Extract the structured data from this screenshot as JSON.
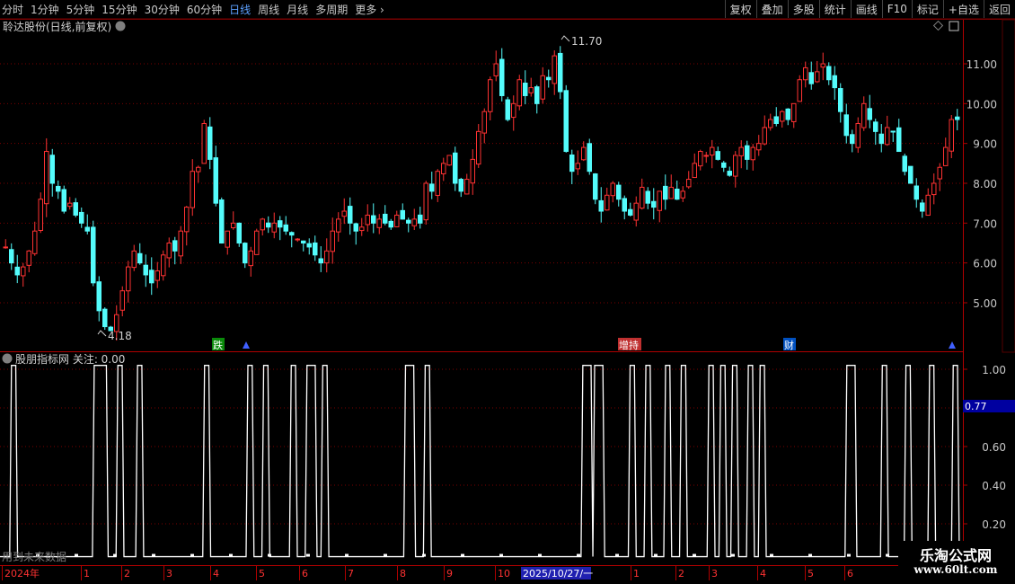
{
  "toolbar": {
    "periods": [
      "分时",
      "1分钟",
      "5分钟",
      "15分钟",
      "30分钟",
      "60分钟",
      "日线",
      "周线",
      "月线",
      "多周期",
      "更多"
    ],
    "active_period": "日线",
    "right_buttons": [
      "复权",
      "叠加",
      "多股",
      "统计",
      "画线",
      "F10",
      "标记",
      "+自选",
      "返回"
    ]
  },
  "stock": {
    "name": "聆达股份",
    "mode": "(日线,前复权)"
  },
  "indicator": {
    "name": "股朋指标网",
    "focus_label": "关注: 0.00",
    "current_value": "0.77"
  },
  "price_axis": [
    "11.00",
    "10.00",
    "9.00",
    "8.00",
    "7.00",
    "6.00",
    "5.00"
  ],
  "ind_axis": [
    "1.00",
    "0.80",
    "0.60",
    "0.40",
    "0.20"
  ],
  "annotations": {
    "high": "11.70",
    "low": "4.18"
  },
  "events": [
    "跌",
    "增持",
    "财"
  ],
  "bottom_text": "用到未来数据",
  "time_axis": {
    "labels": [
      "2024年",
      "1",
      "2",
      "3",
      "4",
      "5",
      "6",
      "7",
      "8",
      "9",
      "10",
      "2025/10/27/一",
      "1",
      "2",
      "3",
      "4",
      "5",
      "6"
    ],
    "cursor_date": "2025/10/27/一"
  },
  "watermark": {
    "title": "乐淘公式网",
    "url": "www.60lt.com"
  },
  "colors": {
    "up": "#ff3232",
    "down": "#54fcfc",
    "grid": "#7a0000",
    "axis_text": "#c8c8c8",
    "active": "#5ca0ff"
  },
  "chart_data": {
    "type": "candlestick+step",
    "price_ylim": [
      4.0,
      12.0
    ],
    "high": 11.7,
    "low": 4.18,
    "close_path": [
      6.4,
      6.0,
      5.7,
      5.9,
      6.3,
      6.8,
      7.6,
      8.8,
      8.0,
      7.8,
      7.3,
      7.5,
      7.2,
      7.0,
      6.8,
      5.5,
      4.8,
      4.4,
      4.3,
      4.7,
      5.3,
      5.9,
      6.3,
      6.0,
      5.7,
      5.5,
      5.8,
      6.2,
      6.5,
      6.3,
      6.8,
      7.4,
      8.3,
      8.4,
      9.5,
      8.6,
      7.5,
      6.5,
      6.8,
      7.0,
      6.5,
      6.0,
      6.3,
      6.8,
      7.1,
      6.9,
      7.0,
      6.9,
      6.8,
      6.7,
      6.6,
      6.5,
      6.4,
      6.2,
      6.0,
      6.3,
      6.8,
      7.1,
      7.3,
      7.0,
      6.8,
      6.9,
      7.2,
      7.0,
      7.1,
      7.0,
      6.9,
      7.2,
      7.1,
      7.0,
      7.1,
      7.0,
      8.0,
      7.8,
      8.3,
      8.5,
      8.7,
      8.0,
      7.8,
      8.1,
      8.6,
      9.3,
      9.8,
      10.6,
      11.0,
      10.2,
      9.6,
      10.0,
      10.6,
      10.2,
      10.4,
      10.0,
      10.7,
      10.6,
      11.2,
      10.3,
      8.8,
      8.3,
      8.5,
      8.9,
      8.3,
      7.6,
      7.3,
      7.7,
      8.0,
      7.6,
      7.3,
      7.2,
      7.5,
      7.9,
      7.5,
      7.4,
      7.8,
      7.6,
      7.9,
      7.6,
      7.8,
      8.1,
      8.5,
      8.8,
      8.7,
      8.9,
      8.6,
      8.4,
      8.2,
      8.7,
      8.9,
      8.6,
      8.9,
      9.0,
      9.4,
      9.6,
      9.5,
      9.8,
      9.6,
      10.0,
      10.6,
      10.9,
      10.5,
      10.8,
      11.0,
      10.6,
      10.4,
      9.8,
      9.2,
      9.0,
      9.5,
      10.0,
      9.6,
      9.3,
      9.0,
      9.4,
      9.3,
      8.8,
      8.3,
      8.0,
      7.6,
      7.3,
      7.7,
      8.0,
      8.4,
      8.9,
      9.6,
      9.6
    ],
    "indicator_ylim": [
      0,
      1.1
    ],
    "indicator_pulses": [
      [
        0.01,
        0.02
      ],
      [
        0.115,
        0.135
      ],
      [
        0.145,
        0.155
      ],
      [
        0.17,
        0.18
      ],
      [
        0.255,
        0.265
      ],
      [
        0.31,
        0.32
      ],
      [
        0.33,
        0.34
      ],
      [
        0.365,
        0.375
      ],
      [
        0.385,
        0.4
      ],
      [
        0.405,
        0.415
      ],
      [
        0.51,
        0.525
      ],
      [
        0.535,
        0.545
      ],
      [
        0.735,
        0.75
      ],
      [
        0.75,
        0.765
      ],
      [
        0.795,
        0.805
      ],
      [
        0.815,
        0.825
      ],
      [
        0.84,
        0.85
      ],
      [
        0.86,
        0.87
      ],
      [
        0.895,
        0.905
      ],
      [
        0.91,
        0.92
      ],
      [
        0.925,
        0.935
      ],
      [
        0.945,
        0.955
      ],
      [
        0.96,
        0.97
      ],
      [
        1.07,
        1.085
      ],
      [
        1.115,
        1.125
      ],
      [
        1.145,
        1.155
      ],
      [
        1.175,
        1.185
      ],
      [
        1.205,
        1.215
      ]
    ]
  }
}
